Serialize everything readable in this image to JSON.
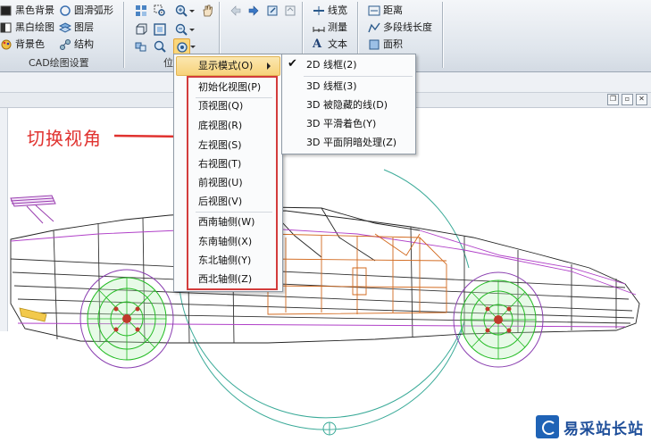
{
  "ribbon": {
    "cad_group": {
      "items": [
        "黑色背景",
        "黑白绘图",
        "背景色",
        "圆滑弧形",
        "图层",
        "结构"
      ],
      "label": "CAD绘图设置"
    },
    "position_group": {
      "label": "位"
    },
    "measure_group": {
      "items": [
        "线宽",
        "测量",
        "文本",
        "距离",
        "多段线长度",
        "面积"
      ]
    }
  },
  "view_menu": {
    "display_mode_label": "显示模式(O)",
    "items": [
      "初始化视图(P)",
      "顶视图(Q)",
      "底视图(R)",
      "左视图(S)",
      "右视图(T)",
      "前视图(U)",
      "后视图(V)",
      "西南轴侧(W)",
      "东南轴侧(X)",
      "东北轴侧(Y)",
      "西北轴侧(Z)"
    ]
  },
  "display_submenu": {
    "items": [
      "2D 线框(2)",
      "3D 线框(3)",
      "3D 被隐藏的线(D)",
      "3D 平滑着色(Y)",
      "3D 平面阴暗处理(Z)"
    ],
    "checked_index": 0
  },
  "annotation": {
    "text": "切换视角"
  },
  "watermark": {
    "text": "易采站长站"
  },
  "colors": {
    "highlight": "#f7d37a",
    "annotation_red": "#e0322f",
    "wheel_green": "#2ecc2e",
    "body_purple": "#b040c8",
    "interior_orange": "#d2691e"
  }
}
